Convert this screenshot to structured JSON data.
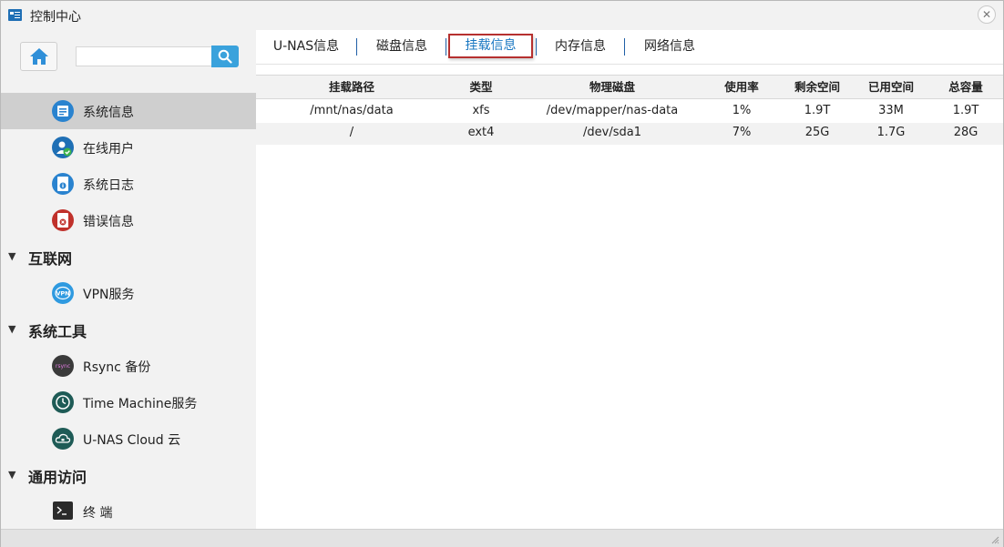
{
  "window": {
    "title": "控制中心",
    "close_glyph": "✕"
  },
  "sidebar": {
    "search_placeholder": "",
    "items": [
      {
        "label": "系统信息",
        "icon": "system-info-icon",
        "color": "#2a83cf",
        "active": true
      },
      {
        "label": "在线用户",
        "icon": "online-user-icon",
        "color": "#1f6fb5"
      },
      {
        "label": "系统日志",
        "icon": "system-log-icon",
        "color": "#2a83cf"
      },
      {
        "label": "错误信息",
        "icon": "error-info-icon",
        "color": "#c0312b"
      }
    ],
    "groups": [
      {
        "label": "互联网",
        "caret": "▼",
        "items": [
          {
            "label": "VPN服务",
            "icon": "vpn-icon",
            "color": "#2f9ae0"
          }
        ]
      },
      {
        "label": "系统工具",
        "caret": "▼",
        "items": [
          {
            "label": "Rsync 备份",
            "icon": "rsync-icon",
            "color": "#3a3a3a"
          },
          {
            "label": "Time Machine服务",
            "icon": "time-machine-icon",
            "color": "#1e5b56"
          },
          {
            "label": "U-NAS Cloud 云",
            "icon": "cloud-icon",
            "color": "#1e5b56"
          }
        ]
      },
      {
        "label": "通用访问",
        "caret": "▼",
        "items": [
          {
            "label": "终 端",
            "icon": "terminal-icon",
            "color": "#2b2b2b"
          }
        ]
      }
    ]
  },
  "tabs": [
    {
      "label": "U-NAS信息"
    },
    {
      "label": "磁盘信息"
    },
    {
      "label": "挂载信息",
      "active": true
    },
    {
      "label": "内存信息"
    },
    {
      "label": "网络信息"
    }
  ],
  "table": {
    "headers": [
      "挂载路径",
      "类型",
      "物理磁盘",
      "使用率",
      "剩余空间",
      "已用空间",
      "总容量"
    ],
    "rows": [
      [
        "/mnt/nas/data",
        "xfs",
        "/dev/mapper/nas-data",
        "1%",
        "1.9T",
        "33M",
        "1.9T"
      ],
      [
        "/",
        "ext4",
        "/dev/sda1",
        "7%",
        "25G",
        "1.7G",
        "28G"
      ]
    ]
  },
  "colors": {
    "accent": "#3aa2dc",
    "active_tab_border": "#b6302f",
    "active_tab_text": "#1a78c2"
  }
}
